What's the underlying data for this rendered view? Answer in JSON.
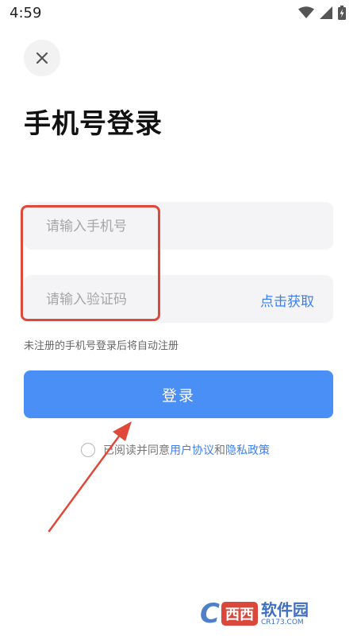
{
  "status_bar": {
    "time": "4:59",
    "icons": [
      "wifi-icon",
      "signal-icon",
      "battery-charging-icon"
    ]
  },
  "header": {
    "close_icon": "close-icon",
    "title": "手机号登录"
  },
  "form": {
    "phone_placeholder": "请输入手机号",
    "phone_value": "",
    "code_placeholder": "请输入验证码",
    "code_value": "",
    "get_code_label": "点击获取",
    "hint": "未注册的手机号登录后将自动注册",
    "login_label": "登录"
  },
  "agreement": {
    "checked": false,
    "prefix": "已阅读并同意",
    "user_agreement": "用户协议",
    "and": "和",
    "privacy_policy": "隐私政策"
  },
  "watermark": {
    "brand": "西西",
    "name": "软件园",
    "url": "CR173.COM"
  },
  "colors": {
    "accent": "#4a8ff6",
    "link": "#3b7ff5",
    "annotation": "#e0493a",
    "field_bg": "#f4f4f6"
  }
}
